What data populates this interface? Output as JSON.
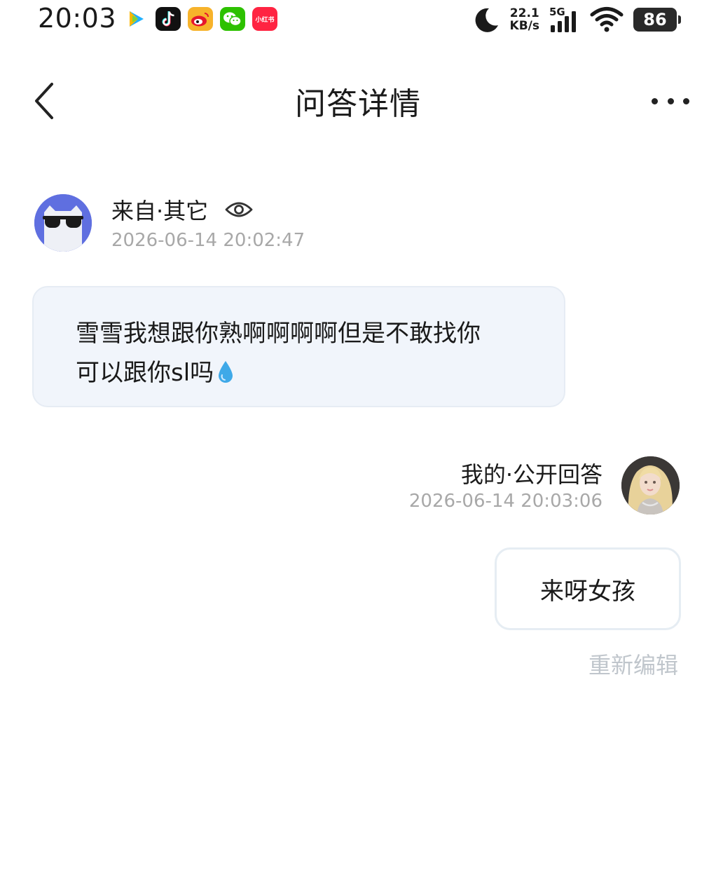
{
  "status_bar": {
    "time": "20:03",
    "apps": [
      {
        "name": "tencent-video-icon",
        "color": "#ffffff"
      },
      {
        "name": "tiktok-icon",
        "color": "#111111"
      },
      {
        "name": "weibo-icon",
        "color": "#f7b32b"
      },
      {
        "name": "wechat-icon",
        "color": "#2dc100"
      },
      {
        "name": "xiaohongshu-icon",
        "color": "#ff2442",
        "text": "小红书"
      }
    ],
    "net_speed_value": "22.1",
    "net_speed_unit": "KB/s",
    "network_type": "5G",
    "battery": "86"
  },
  "nav": {
    "title": "问答详情"
  },
  "question": {
    "source": "来自·其它",
    "time": "2026-06-14 20:02:47",
    "text_line1": "雪雪我想跟你熟啊啊啊啊但是不敢找你",
    "text_line2": "可以跟你sl吗"
  },
  "answer": {
    "label": "我的·公开回答",
    "time": "2026-06-14 20:03:06",
    "text": "来呀女孩",
    "reedit_label": "重新编辑"
  },
  "colors": {
    "asker_avatar_bg": "#5f6fe0",
    "question_bubble_bg": "#f1f5fb",
    "muted_text": "#a8a8a8",
    "reedit_text": "#c0c6cc"
  }
}
